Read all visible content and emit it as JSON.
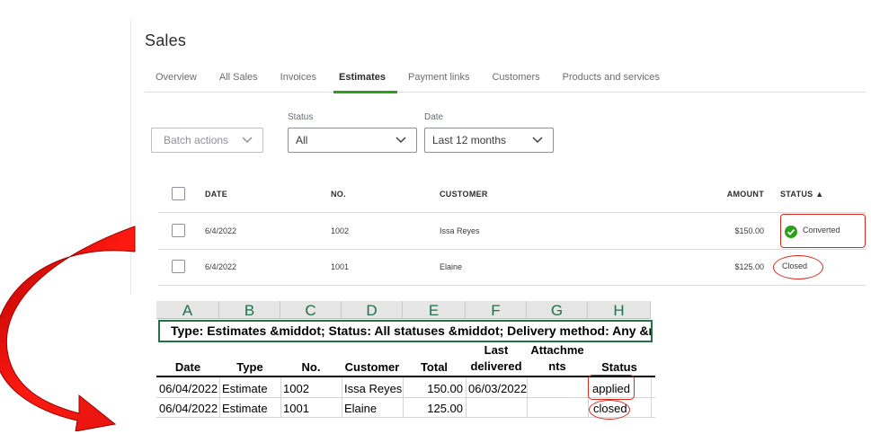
{
  "sales": {
    "title": "Sales",
    "tabs": [
      "Overview",
      "All Sales",
      "Invoices",
      "Estimates",
      "Payment links",
      "Customers",
      "Products and services"
    ],
    "active_tab": "Estimates",
    "batch_actions": "Batch actions",
    "status_filter": {
      "label": "Status",
      "value": "All"
    },
    "date_filter": {
      "label": "Date",
      "value": "Last 12 months"
    },
    "columns": {
      "date": "DATE",
      "no": "NO.",
      "customer": "CUSTOMER",
      "amount": "AMOUNT",
      "status": "STATUS ▲"
    },
    "rows": [
      {
        "date": "6/4/2022",
        "no": "1002",
        "customer": "Issa Reyes",
        "amount": "$150.00",
        "status": "Converted"
      },
      {
        "date": "6/4/2022",
        "no": "1001",
        "customer": "Elaine",
        "amount": "$125.00",
        "status": "Closed"
      }
    ]
  },
  "sheet": {
    "column_letters": [
      "A",
      "B",
      "C",
      "D",
      "E",
      "F",
      "G",
      "H"
    ],
    "title": "Type: Estimates &middot; Status: All statuses &middot; Delivery method: Any &middot;",
    "headers": {
      "date": "Date",
      "type": "Type",
      "no": "No.",
      "customer": "Customer",
      "total": "Total",
      "last_delivered_1": "Last",
      "last_delivered_2": "delivered",
      "attachments_1": "Attachme",
      "attachments_2": "nts",
      "status": "Status"
    },
    "rows": [
      {
        "date": "06/04/2022",
        "type": "Estimate",
        "no": "1002",
        "customer": "Issa Reyes",
        "total": "150.00",
        "last_delivered": "06/03/2022",
        "status": "applied"
      },
      {
        "date": "06/04/2022",
        "type": "Estimate",
        "no": "1001",
        "customer": "Elaine",
        "total": "125.00",
        "last_delivered": "",
        "status": "closed"
      }
    ]
  },
  "colors": {
    "accent_green": "#2ca01c",
    "annotation_red": "#d8281b",
    "excel_green": "#217346",
    "arrow_red": "#e0140f"
  },
  "icons": [
    "chevron-down-icon",
    "check-circle-icon",
    "curved-arrow-icon"
  ]
}
